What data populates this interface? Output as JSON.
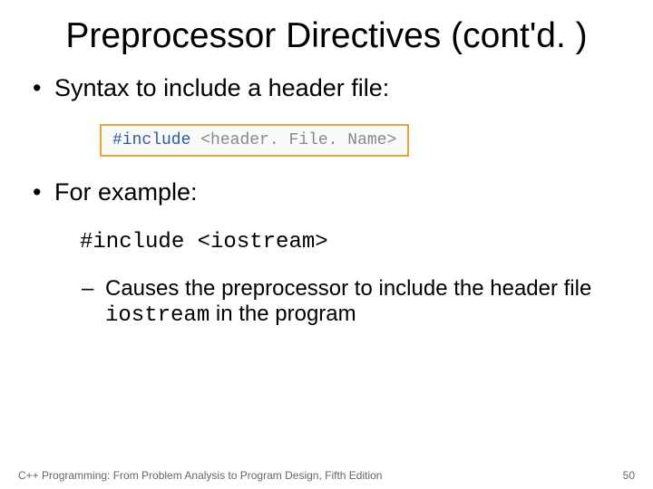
{
  "title": "Preprocessor Directives (cont'd. )",
  "bullets": {
    "syntax": "Syntax to include a header file:",
    "forExample": "For example:"
  },
  "codebox": {
    "keyword": "#include",
    "arg": "<header. File. Name>"
  },
  "exampleCode": "#include <iostream>",
  "sub": {
    "prefix": "Causes the preprocessor to include the header file ",
    "code": "iostream",
    "suffix": " in the program"
  },
  "footer": {
    "book": "C++ Programming: From Problem Analysis to Program Design, Fifth Edition",
    "page": "50"
  }
}
